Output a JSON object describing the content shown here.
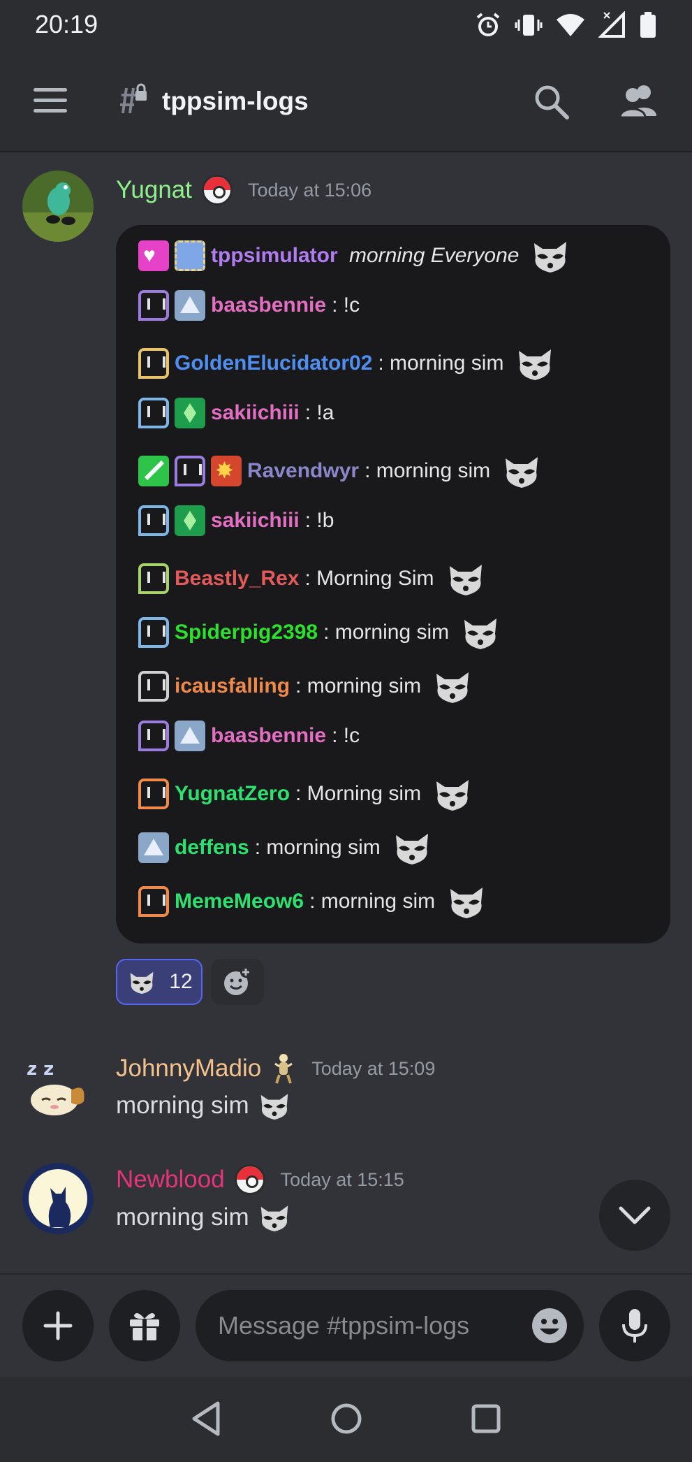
{
  "status_bar": {
    "time": "20:19",
    "icons": [
      "alarm-icon",
      "vibrate-icon",
      "wifi-icon",
      "signal-icon",
      "battery-icon"
    ]
  },
  "header": {
    "channel_name": "tppsim-logs",
    "channel_icon": "locked-hash-icon",
    "menu_icon": "hamburger-icon",
    "search_icon": "search-icon",
    "members_icon": "members-icon"
  },
  "messages": [
    {
      "username": "Yugnat",
      "username_color": "#8ef28a",
      "badge": "pokeball-icon",
      "timestamp": "Today at 15:06",
      "embed": {
        "lines": [
          {
            "badges": [
              "heart",
              "sub"
            ],
            "user": "tppsimulator",
            "user_color": "#b07cf0",
            "text": " morning Everyone",
            "italic": true,
            "emote": true
          },
          {
            "badges": [
              "tw-purple",
              "tri"
            ],
            "user": "baasbennie",
            "user_color": "#e26fc2",
            "text": ": !c",
            "emote": false
          },
          {
            "badges": [
              "tw-gold"
            ],
            "user": "GoldenElucidator02",
            "user_color": "#4f8ff2",
            "text": ": morning sim",
            "emote": true
          },
          {
            "badges": [
              "tw-blue",
              "gem"
            ],
            "user": "sakiichiii",
            "user_color": "#e26fc2",
            "text": ": !a",
            "emote": false
          },
          {
            "badges": [
              "sword",
              "tw-purple",
              "star"
            ],
            "user": "Ravendwyr",
            "user_color": "#8a86c9",
            "text": ": morning sim",
            "emote": true
          },
          {
            "badges": [
              "tw-blue",
              "gem"
            ],
            "user": "sakiichiii",
            "user_color": "#e26fc2",
            "text": ": !b",
            "emote": false
          },
          {
            "badges": [
              "tw-green"
            ],
            "user": "Beastly_Rex",
            "user_color": "#e25a5a",
            "text": ": Morning Sim",
            "emote": true
          },
          {
            "badges": [
              "tw-blue"
            ],
            "user": "Spiderpig2398",
            "user_color": "#2de02d",
            "text": ": morning sim",
            "emote": true
          },
          {
            "badges": [
              "tw-gray"
            ],
            "user": "icausfalling",
            "user_color": "#f08a4b",
            "text": ": morning sim",
            "emote": true
          },
          {
            "badges": [
              "tw-purple",
              "tri"
            ],
            "user": "baasbennie",
            "user_color": "#e26fc2",
            "text": ": !c",
            "emote": false
          },
          {
            "badges": [
              "tw-orange"
            ],
            "user": "YugnatZero",
            "user_color": "#2de070",
            "text": ": Morning sim",
            "emote": true
          },
          {
            "badges": [
              "tri"
            ],
            "user": "deffens",
            "user_color": "#2de070",
            "text": ": morning sim",
            "emote": true
          },
          {
            "badges": [
              "tw-orange"
            ],
            "user": "MemeMeow6",
            "user_color": "#2de070",
            "text": ": morning sim",
            "emote": true
          }
        ]
      },
      "reaction": {
        "emoji": "raccoon-emote",
        "count": "12"
      }
    },
    {
      "username": "JohnnyMadio",
      "username_color": "#f5c28e",
      "badge": "pokemon-figure-icon",
      "timestamp": "Today at 15:09",
      "text": "morning sim"
    },
    {
      "username": "Newblood",
      "username_color": "#e5347a",
      "badge": "pokeball-icon",
      "timestamp": "Today at 15:15",
      "text": "morning sim"
    }
  ],
  "composer": {
    "placeholder": "Message #tppsim-logs",
    "add_icon": "plus-icon",
    "gift_icon": "gift-icon",
    "emoji_icon": "emoji-icon",
    "mic_icon": "microphone-icon"
  },
  "nav": [
    "back-icon",
    "home-icon",
    "recents-icon"
  ]
}
